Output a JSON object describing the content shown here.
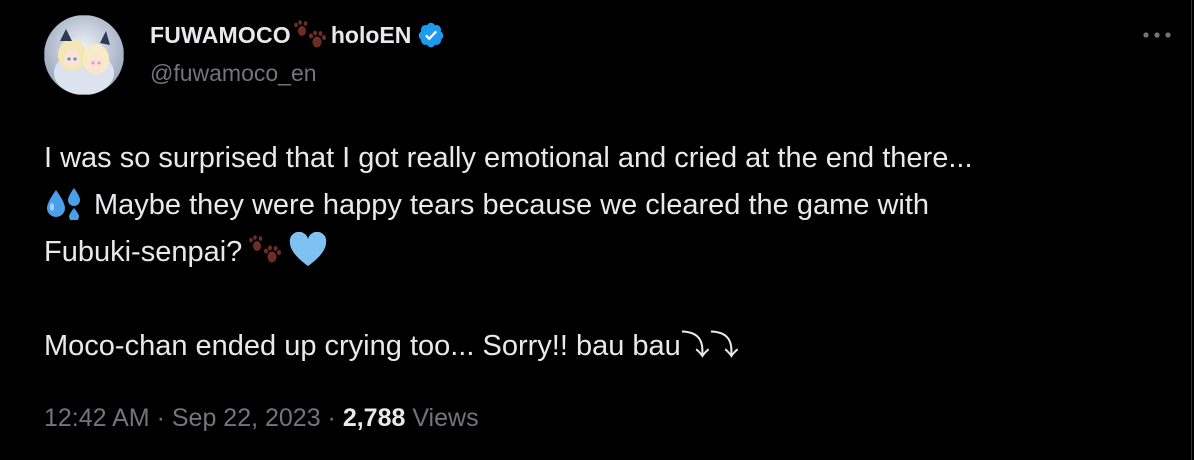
{
  "tweet": {
    "author": {
      "display_name_part1": "FUWAMOCO",
      "display_name_part2": "holoEN",
      "handle": "@fuwamoco_en",
      "avatar_icon": "profile-avatar",
      "verified_icon": "verified-badge-icon",
      "verified_color": "#1d9bf0"
    },
    "more_icon": "more-options-icon",
    "body": {
      "line1": "I was so surprised that I got really emotional and cried at the end there...",
      "line2_text": "Maybe they were happy tears because we cleared the game with",
      "line3_text": "Fubuki-senpai?",
      "line4": "Moco-chan ended up crying too... Sorry!! bau bau⤵⤵",
      "emoji": {
        "sweat_drops": "💦",
        "paw": "🐾",
        "heart": "🩵"
      }
    },
    "meta": {
      "time": "12:42 AM",
      "sep1": " · ",
      "date": "Sep 22, 2023",
      "sep2": " · ",
      "views_count": "2,788",
      "views_label": " Views"
    },
    "colors": {
      "background": "#000000",
      "text": "#e7e9ea",
      "secondary": "#71767b",
      "paw": "#6b2f26",
      "heart": "#7fc2f2",
      "drops": "#4a9fe8"
    }
  }
}
